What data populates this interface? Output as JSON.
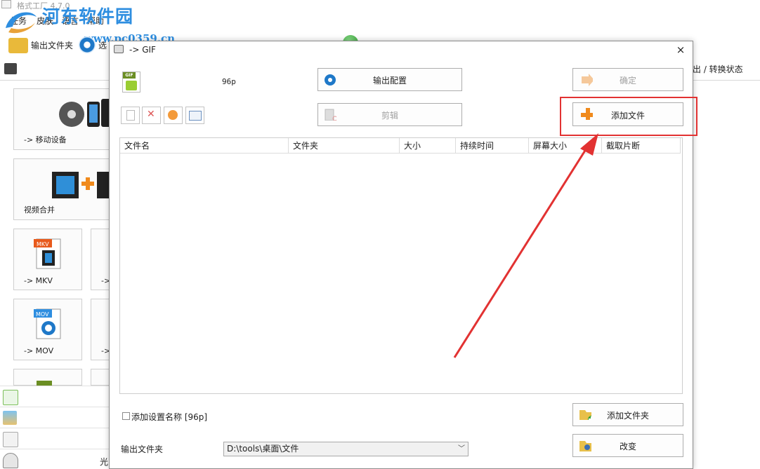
{
  "app": {
    "title": "格式工厂 4.7.0",
    "watermark_text": "河东软件园",
    "watermark_url": "www.pc0359.cn"
  },
  "menu": [
    "任务",
    "皮肤",
    "语言",
    "帮助"
  ],
  "toolbar": {
    "output_folder_label": "输出文件夹",
    "options_label": "选"
  },
  "status_header": "出 / 转换状态",
  "left_panel": {
    "tiles": [
      {
        "label": "-> 移动设备"
      },
      {
        "label": "视频合并"
      },
      {
        "label": "-> MKV"
      },
      {
        "label": "-> MOV"
      }
    ],
    "partial_labels": [
      "->",
      "->"
    ],
    "bottom_label": "光"
  },
  "dialog": {
    "title": "-> GIF",
    "close_glyph": "×",
    "format_icon_text": "GIF",
    "resolution": "96p",
    "output_config_label": "输出配置",
    "ok_label": "确定",
    "clip_label": "剪辑",
    "add_file_label": "添加文件",
    "table_columns": [
      "文件名",
      "文件夹",
      "大小",
      "持续时间",
      "屏幕大小",
      "截取片断"
    ],
    "setting_name_label": "添加设置名称 [96p]",
    "add_folder_label": "添加文件夹",
    "change_label": "改变",
    "output_folder_label": "输出文件夹",
    "output_folder_value": "D:\\tools\\桌面\\文件"
  },
  "colors": {
    "highlight": "#e23232",
    "watermark": "#2e8ee0"
  }
}
